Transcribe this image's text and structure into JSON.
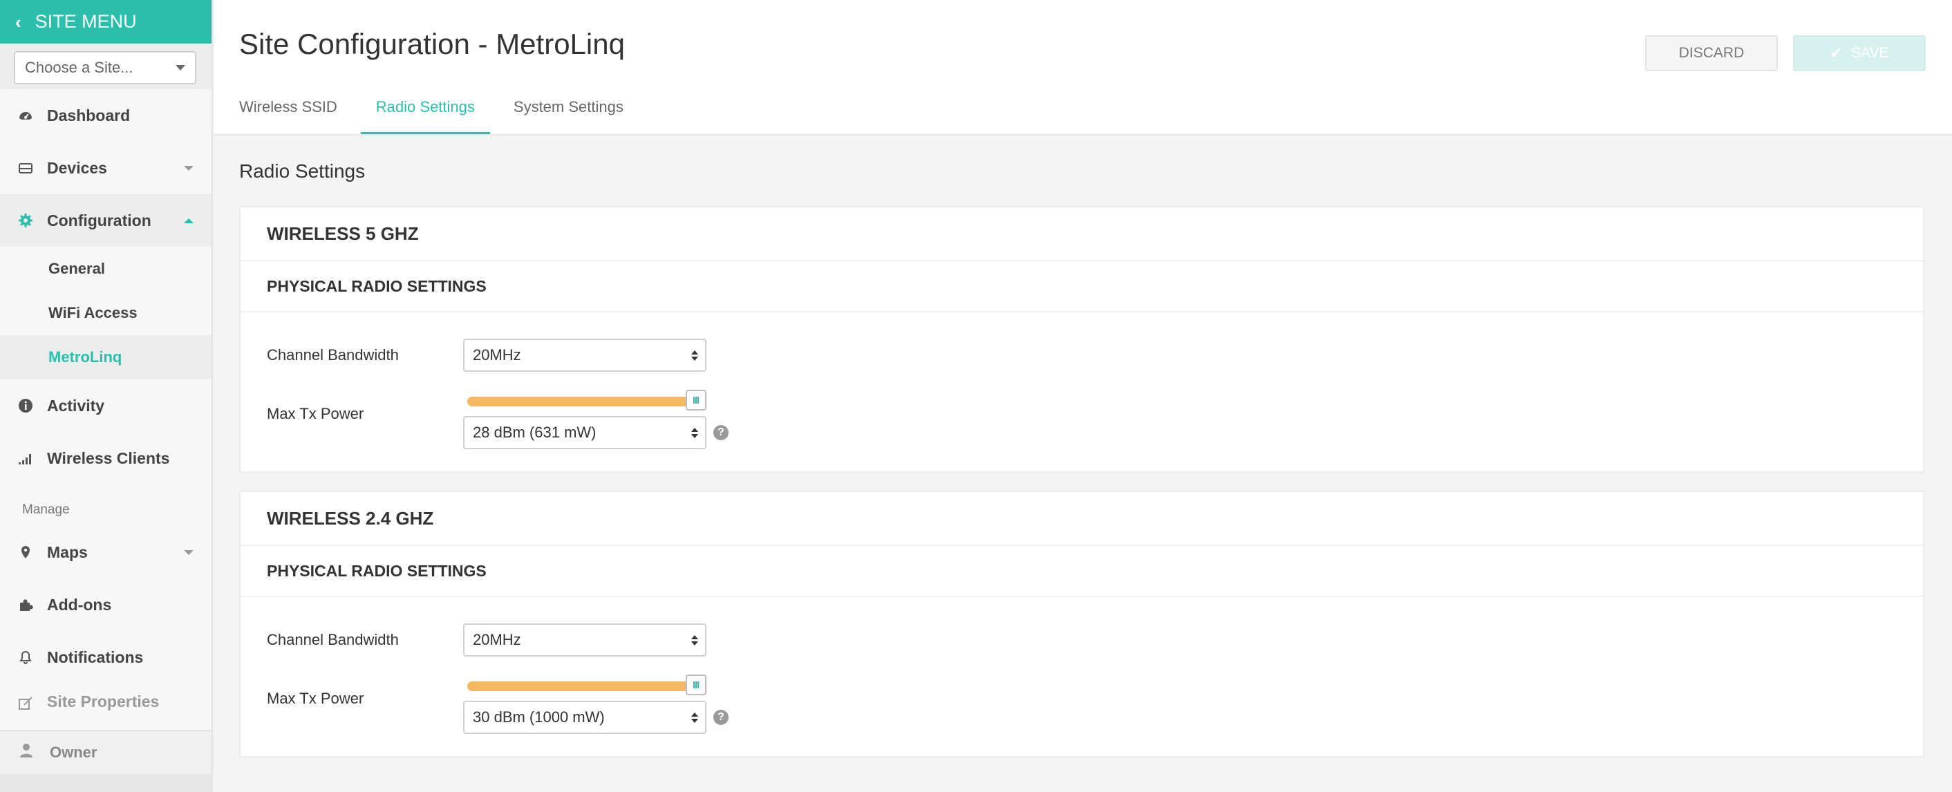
{
  "sidebar": {
    "title": "SITE MENU",
    "site_select_placeholder": "Choose a Site...",
    "items": [
      {
        "label": "Dashboard",
        "icon": "dashboard-icon"
      },
      {
        "label": "Devices",
        "icon": "inbox-icon"
      },
      {
        "label": "Configuration",
        "icon": "gear-icon"
      },
      {
        "label": "Activity",
        "icon": "info-icon"
      },
      {
        "label": "Wireless Clients",
        "icon": "signal-bars-icon"
      },
      {
        "label": "Maps",
        "icon": "map-pin-icon"
      },
      {
        "label": "Add-ons",
        "icon": "puzzle-icon"
      },
      {
        "label": "Notifications",
        "icon": "bell-icon"
      },
      {
        "label": "Site Properties",
        "icon": "edit-icon"
      }
    ],
    "sub_items": [
      "General",
      "WiFi Access",
      "MetroLinq"
    ],
    "section_manage": "Manage",
    "owner": "Owner"
  },
  "header": {
    "title": "Site Configuration - MetroLinq",
    "discard_label": "DISCARD",
    "save_label": "SAVE",
    "tabs": [
      "Wireless SSID",
      "Radio Settings",
      "System Settings"
    ],
    "active_tab": "Radio Settings"
  },
  "content": {
    "heading": "Radio Settings",
    "cards": [
      {
        "title": "WIRELESS 5 GHZ",
        "subtitle": "PHYSICAL RADIO SETTINGS",
        "channel_label": "Channel Bandwidth",
        "channel_value": "20MHz",
        "power_label": "Max Tx Power",
        "power_value": "28 dBm (631 mW)",
        "slider_level": 1.0
      },
      {
        "title": "WIRELESS 2.4 GHZ",
        "subtitle": "PHYSICAL RADIO SETTINGS",
        "channel_label": "Channel Bandwidth",
        "channel_value": "20MHz",
        "power_label": "Max Tx Power",
        "power_value": "30 dBm (1000 mW)",
        "slider_level": 1.0
      }
    ]
  },
  "colors": {
    "accent": "#2bbfab",
    "slider": "#f4b95e"
  }
}
